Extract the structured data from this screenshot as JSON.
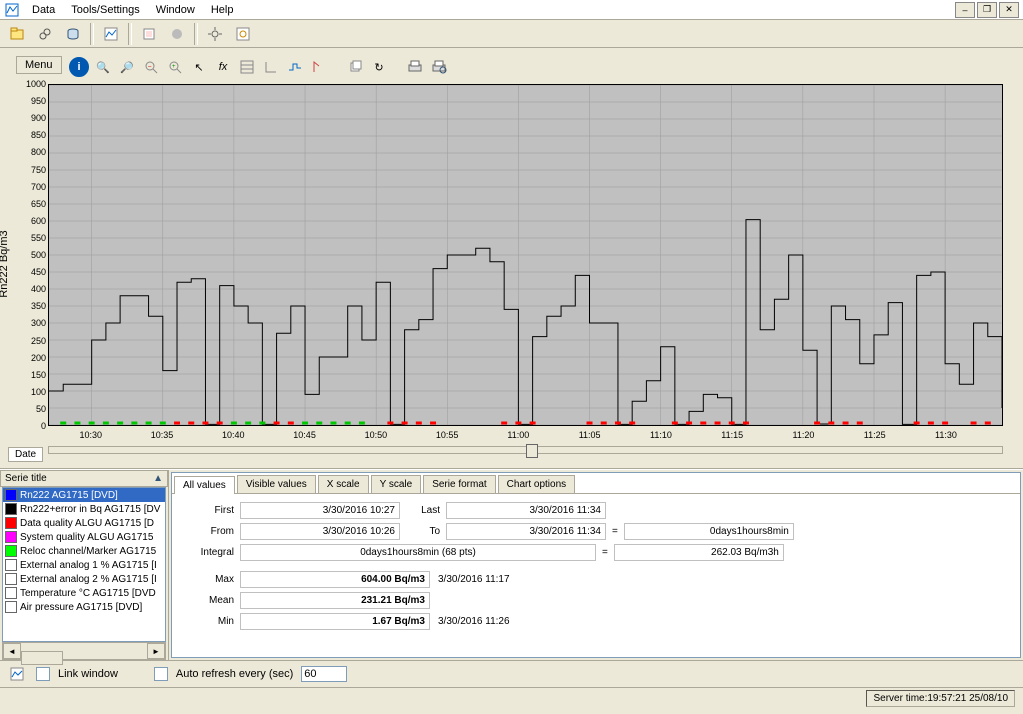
{
  "menubar": {
    "items": [
      "Data",
      "Tools/Settings",
      "Window",
      "Help"
    ]
  },
  "chart_menu_btn": "Menu",
  "date_label": "Date",
  "y_axis_title": "Rn222 Bq/m3",
  "serie_header": "Serie title",
  "series": [
    {
      "color": "#0000ff",
      "label": "Rn222 AG1715   [DVD]",
      "selected": true
    },
    {
      "color": "#000000",
      "label": "Rn222+error in Bq AG1715   [DV"
    },
    {
      "color": "#ff0000",
      "label": "Data quality ALGU AG1715   [D"
    },
    {
      "color": "#ff00ff",
      "label": "System quality ALGU AG1715"
    },
    {
      "color": "#00ff00",
      "label": "Reloc channel/Marker AG1715"
    },
    {
      "color": "#ffffff",
      "label": "External analog 1 % AG1715   [I"
    },
    {
      "color": "#ffffff",
      "label": "External analog 2 % AG1715   [I"
    },
    {
      "color": "#ffffff",
      "label": "Temperature °C AG1715   [DVD"
    },
    {
      "color": "#ffffff",
      "label": "Air pressure AG1715   [DVD]"
    }
  ],
  "tabs": [
    "All values",
    "Visible values",
    "X scale",
    "Y scale",
    "Serie format",
    "Chart options"
  ],
  "active_tab": 0,
  "fields": {
    "first_label": "First",
    "first": "3/30/2016 10:27",
    "last_label": "Last",
    "last": "3/30/2016 11:34",
    "from_label": "From",
    "from": "3/30/2016 10:26",
    "to_label": "To",
    "to": "3/30/2016 11:34",
    "range": "0days1hours8min",
    "integral_label": "Integral",
    "integral": "0days1hours8min (68 pts)",
    "integral_val": "262.03 Bq/m3h",
    "max_label": "Max",
    "max": "604.00 Bq/m3",
    "max_at": "3/30/2016 11:17",
    "mean_label": "Mean",
    "mean": "231.21 Bq/m3",
    "min_label": "Min",
    "min": "1.67 Bq/m3",
    "min_at": "3/30/2016 11:26"
  },
  "footer": {
    "link_window": "Link window",
    "auto_refresh": "Auto refresh every (sec)",
    "refresh_val": "60"
  },
  "status": "Server time:19:57:21 25/08/10",
  "chart_data": {
    "type": "line",
    "title": "",
    "xlabel": "",
    "ylabel": "Rn222 Bq/m3",
    "ylim": [
      0,
      1000
    ],
    "yticks": [
      0,
      50,
      100,
      150,
      200,
      250,
      300,
      350,
      400,
      450,
      500,
      550,
      600,
      650,
      700,
      750,
      800,
      850,
      900,
      950,
      1000
    ],
    "xticks": [
      "10:30",
      "10:35",
      "10:40",
      "10:45",
      "10:50",
      "10:55",
      "11:00",
      "11:05",
      "11:10",
      "11:15",
      "11:20",
      "11:25",
      "11:30"
    ],
    "x": [
      627,
      628,
      629,
      630,
      631,
      632,
      633,
      634,
      635,
      636,
      637,
      638,
      639,
      640,
      641,
      642,
      643,
      644,
      645,
      646,
      647,
      648,
      649,
      650,
      651,
      652,
      653,
      654,
      655,
      656,
      657,
      658,
      659,
      660,
      661,
      662,
      663,
      664,
      665,
      666,
      667,
      668,
      669,
      670,
      671,
      672,
      673,
      674,
      675,
      676,
      677,
      678,
      679,
      680,
      681,
      682,
      683,
      684,
      685,
      686,
      687,
      688,
      689,
      690,
      691,
      692,
      693,
      694
    ],
    "values": [
      100,
      120,
      120,
      250,
      300,
      380,
      380,
      320,
      160,
      420,
      430,
      2,
      410,
      350,
      300,
      2,
      270,
      350,
      90,
      200,
      200,
      350,
      250,
      420,
      2,
      280,
      310,
      460,
      500,
      500,
      520,
      480,
      340,
      2,
      260,
      320,
      350,
      440,
      300,
      300,
      2,
      70,
      130,
      230,
      2,
      40,
      90,
      80,
      2,
      604,
      280,
      370,
      500,
      220,
      3,
      350,
      310,
      180,
      265,
      360,
      2,
      440,
      450,
      180,
      120,
      300,
      260,
      50
    ],
    "markers_green": [
      628,
      629,
      630,
      631,
      632,
      633,
      634,
      635,
      640,
      641,
      642,
      645,
      646,
      647,
      648,
      649
    ],
    "markers_red": [
      636,
      637,
      638,
      639,
      643,
      644,
      651,
      652,
      653,
      654,
      659,
      660,
      661,
      665,
      666,
      667,
      668,
      671,
      672,
      673,
      674,
      675,
      676,
      681,
      682,
      683,
      684,
      688,
      689,
      690,
      692,
      693
    ]
  }
}
